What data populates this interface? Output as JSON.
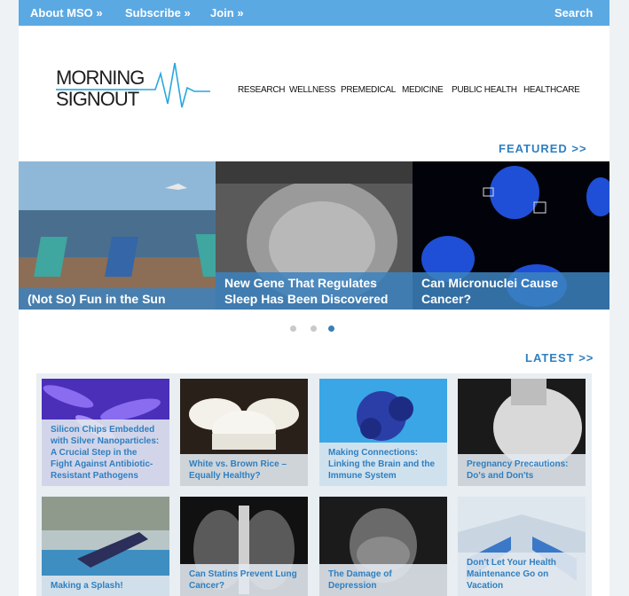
{
  "topbar": {
    "about": "About MSO »",
    "subscribe": "Subscribe »",
    "join": "Join »",
    "search": "Search"
  },
  "logo": {
    "line1": "MORNING",
    "line2": "SIGNOUT"
  },
  "nav": [
    "RESEARCH",
    "WELLNESS",
    "PREMEDICAL",
    "MEDICINE",
    "PUBLIC HEALTH",
    "HEALTHCARE"
  ],
  "featured_link": "FEATURED >>",
  "latest_link": "LATEST >>",
  "featured": [
    {
      "title": "(Not So) Fun in the Sun"
    },
    {
      "title": "New Gene That Regulates Sleep Has Been Discovered"
    },
    {
      "title": "Can Micronuclei Cause Cancer?"
    }
  ],
  "carousel": {
    "count": 3,
    "active_index": 2
  },
  "latest": [
    {
      "title": "Silicon Chips Embedded with Silver Nanoparticles: A Crucial Step in the Fight Against Antibiotic-Resistant Pathogens"
    },
    {
      "title": "White vs. Brown Rice – Equally Healthy?"
    },
    {
      "title": "Making Connections: Linking the Brain and the Immune System"
    },
    {
      "title": "Pregnancy Precautions: Do's and Don'ts"
    },
    {
      "title": "Making a Splash!"
    },
    {
      "title": "Can Statins Prevent Lung Cancer?"
    },
    {
      "title": "The Damage of Depression"
    },
    {
      "title": "Don't Let Your Health Maintenance Go on Vacation"
    }
  ],
  "colors": {
    "topbar": "#5ba9e3",
    "accent": "#2f7fc0",
    "caption_bg": "#3c82be"
  }
}
